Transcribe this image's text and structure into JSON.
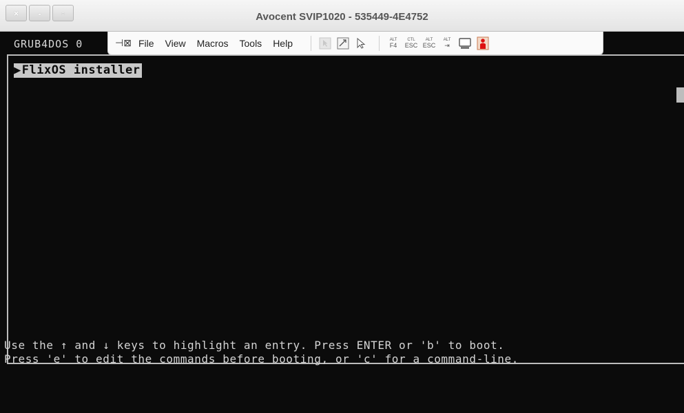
{
  "window": {
    "title": "Avocent SVIP1020 - 535449-4E4752",
    "controls": {
      "close": "×",
      "minimize": "-",
      "maximize": "▫"
    }
  },
  "toolbar": {
    "pin_icon": "pin-icon",
    "menus": [
      "File",
      "View",
      "Macros",
      "Tools",
      "Help"
    ],
    "keys": [
      {
        "mod": "ALT",
        "key": "F4"
      },
      {
        "mod": "CTL",
        "key": "ESC"
      },
      {
        "mod": "ALT",
        "key": "ESC"
      },
      {
        "mod": "ALT",
        "key": "⇥"
      }
    ]
  },
  "console": {
    "header": "GRUB4DOS 0",
    "menu_entries": [
      {
        "marker": "▶",
        "label": "FlixOS installer",
        "selected": true
      }
    ],
    "help_line_1": "Use the ↑ and ↓ keys to highlight an entry. Press ENTER or 'b' to boot.",
    "help_line_2": "Press 'e' to edit the commands before booting, or 'c' for a command-line."
  },
  "colors": {
    "terminal_bg": "#0b0b0b",
    "terminal_fg": "#cfcfcf",
    "highlight_bg": "#c8c8c8"
  }
}
